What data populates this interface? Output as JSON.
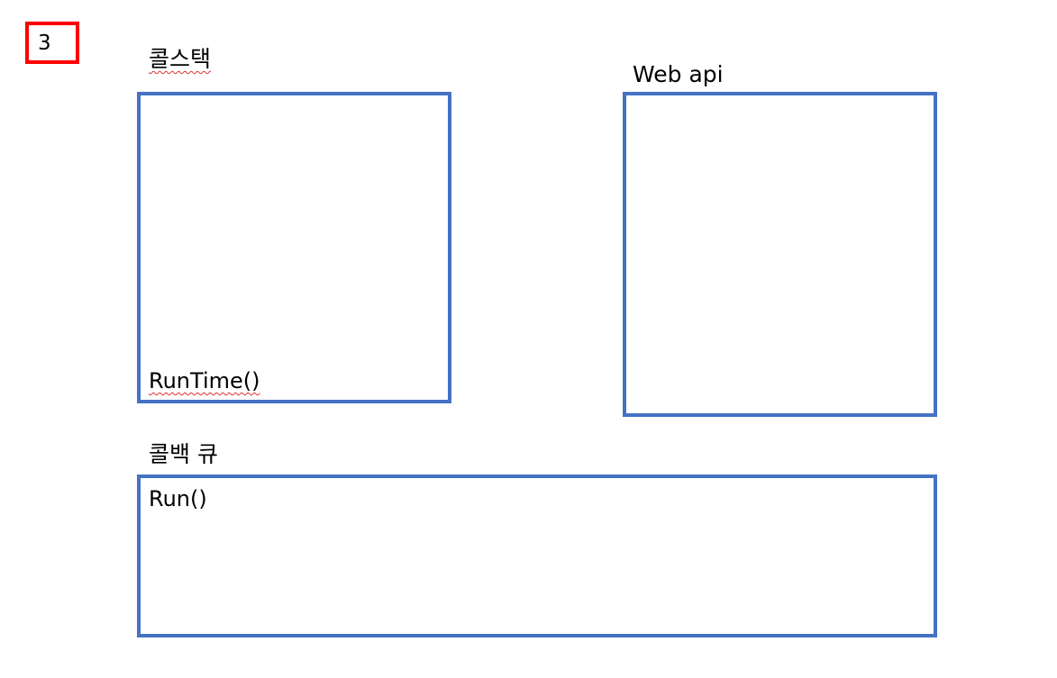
{
  "step_number": "3",
  "call_stack": {
    "title": "콜스택",
    "items": [
      "RunTime()"
    ]
  },
  "web_api": {
    "title": "Web api"
  },
  "callback_queue": {
    "title": "콜백 큐",
    "items": [
      "Run()"
    ]
  },
  "colors": {
    "box_border": "#4472c4",
    "badge_border": "#ff0000"
  }
}
